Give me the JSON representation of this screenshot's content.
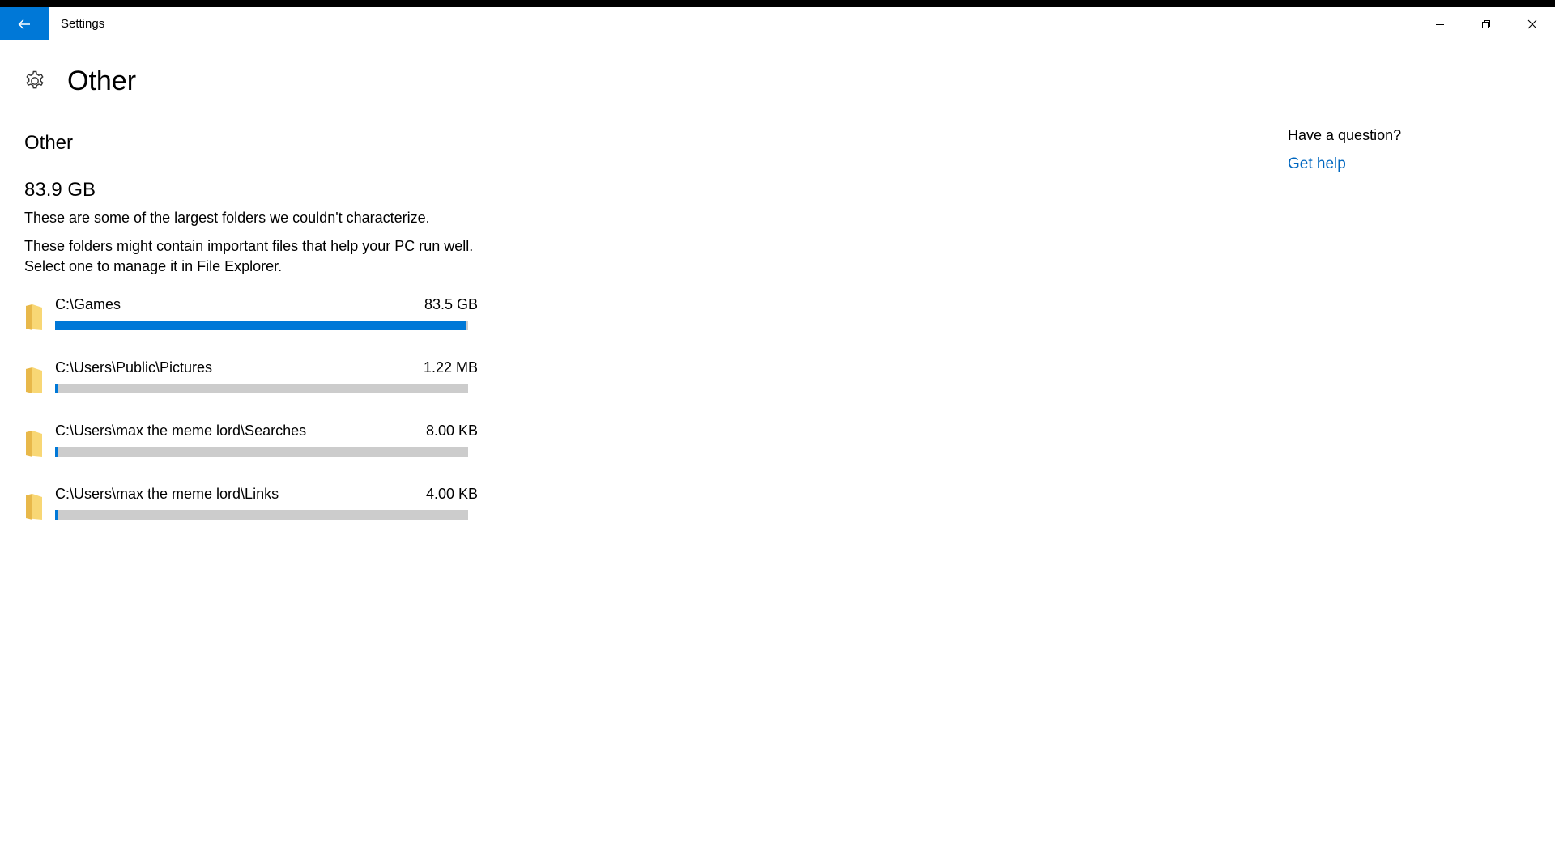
{
  "window": {
    "title": "Settings",
    "back_icon": "arrow-left-icon",
    "controls": [
      "minimize-icon",
      "restore-icon",
      "close-icon"
    ]
  },
  "header": {
    "icon": "gear-icon",
    "title": "Other"
  },
  "main": {
    "section_title": "Other",
    "total_size": "83.9 GB",
    "description_1": "These are some of the largest folders we couldn't characterize.",
    "description_2": "These folders might contain important files that help your PC run well. Select one to manage it in File Explorer.",
    "folders": [
      {
        "path": "C:\\Games",
        "size": "83.5 GB",
        "fraction": 0.995
      },
      {
        "path": "C:\\Users\\Public\\Pictures",
        "size": "1.22 MB",
        "fraction": 0.0
      },
      {
        "path": "C:\\Users\\max the meme lord\\Searches",
        "size": "8.00 KB",
        "fraction": 0.0
      },
      {
        "path": "C:\\Users\\max the meme lord\\Links",
        "size": "4.00 KB",
        "fraction": 0.0
      }
    ]
  },
  "help": {
    "question": "Have a question?",
    "link": "Get help"
  },
  "colors": {
    "accent": "#0078d7",
    "link": "#0067c0",
    "bar_track": "#cccccc",
    "folder_yellow": "#f8d775"
  }
}
